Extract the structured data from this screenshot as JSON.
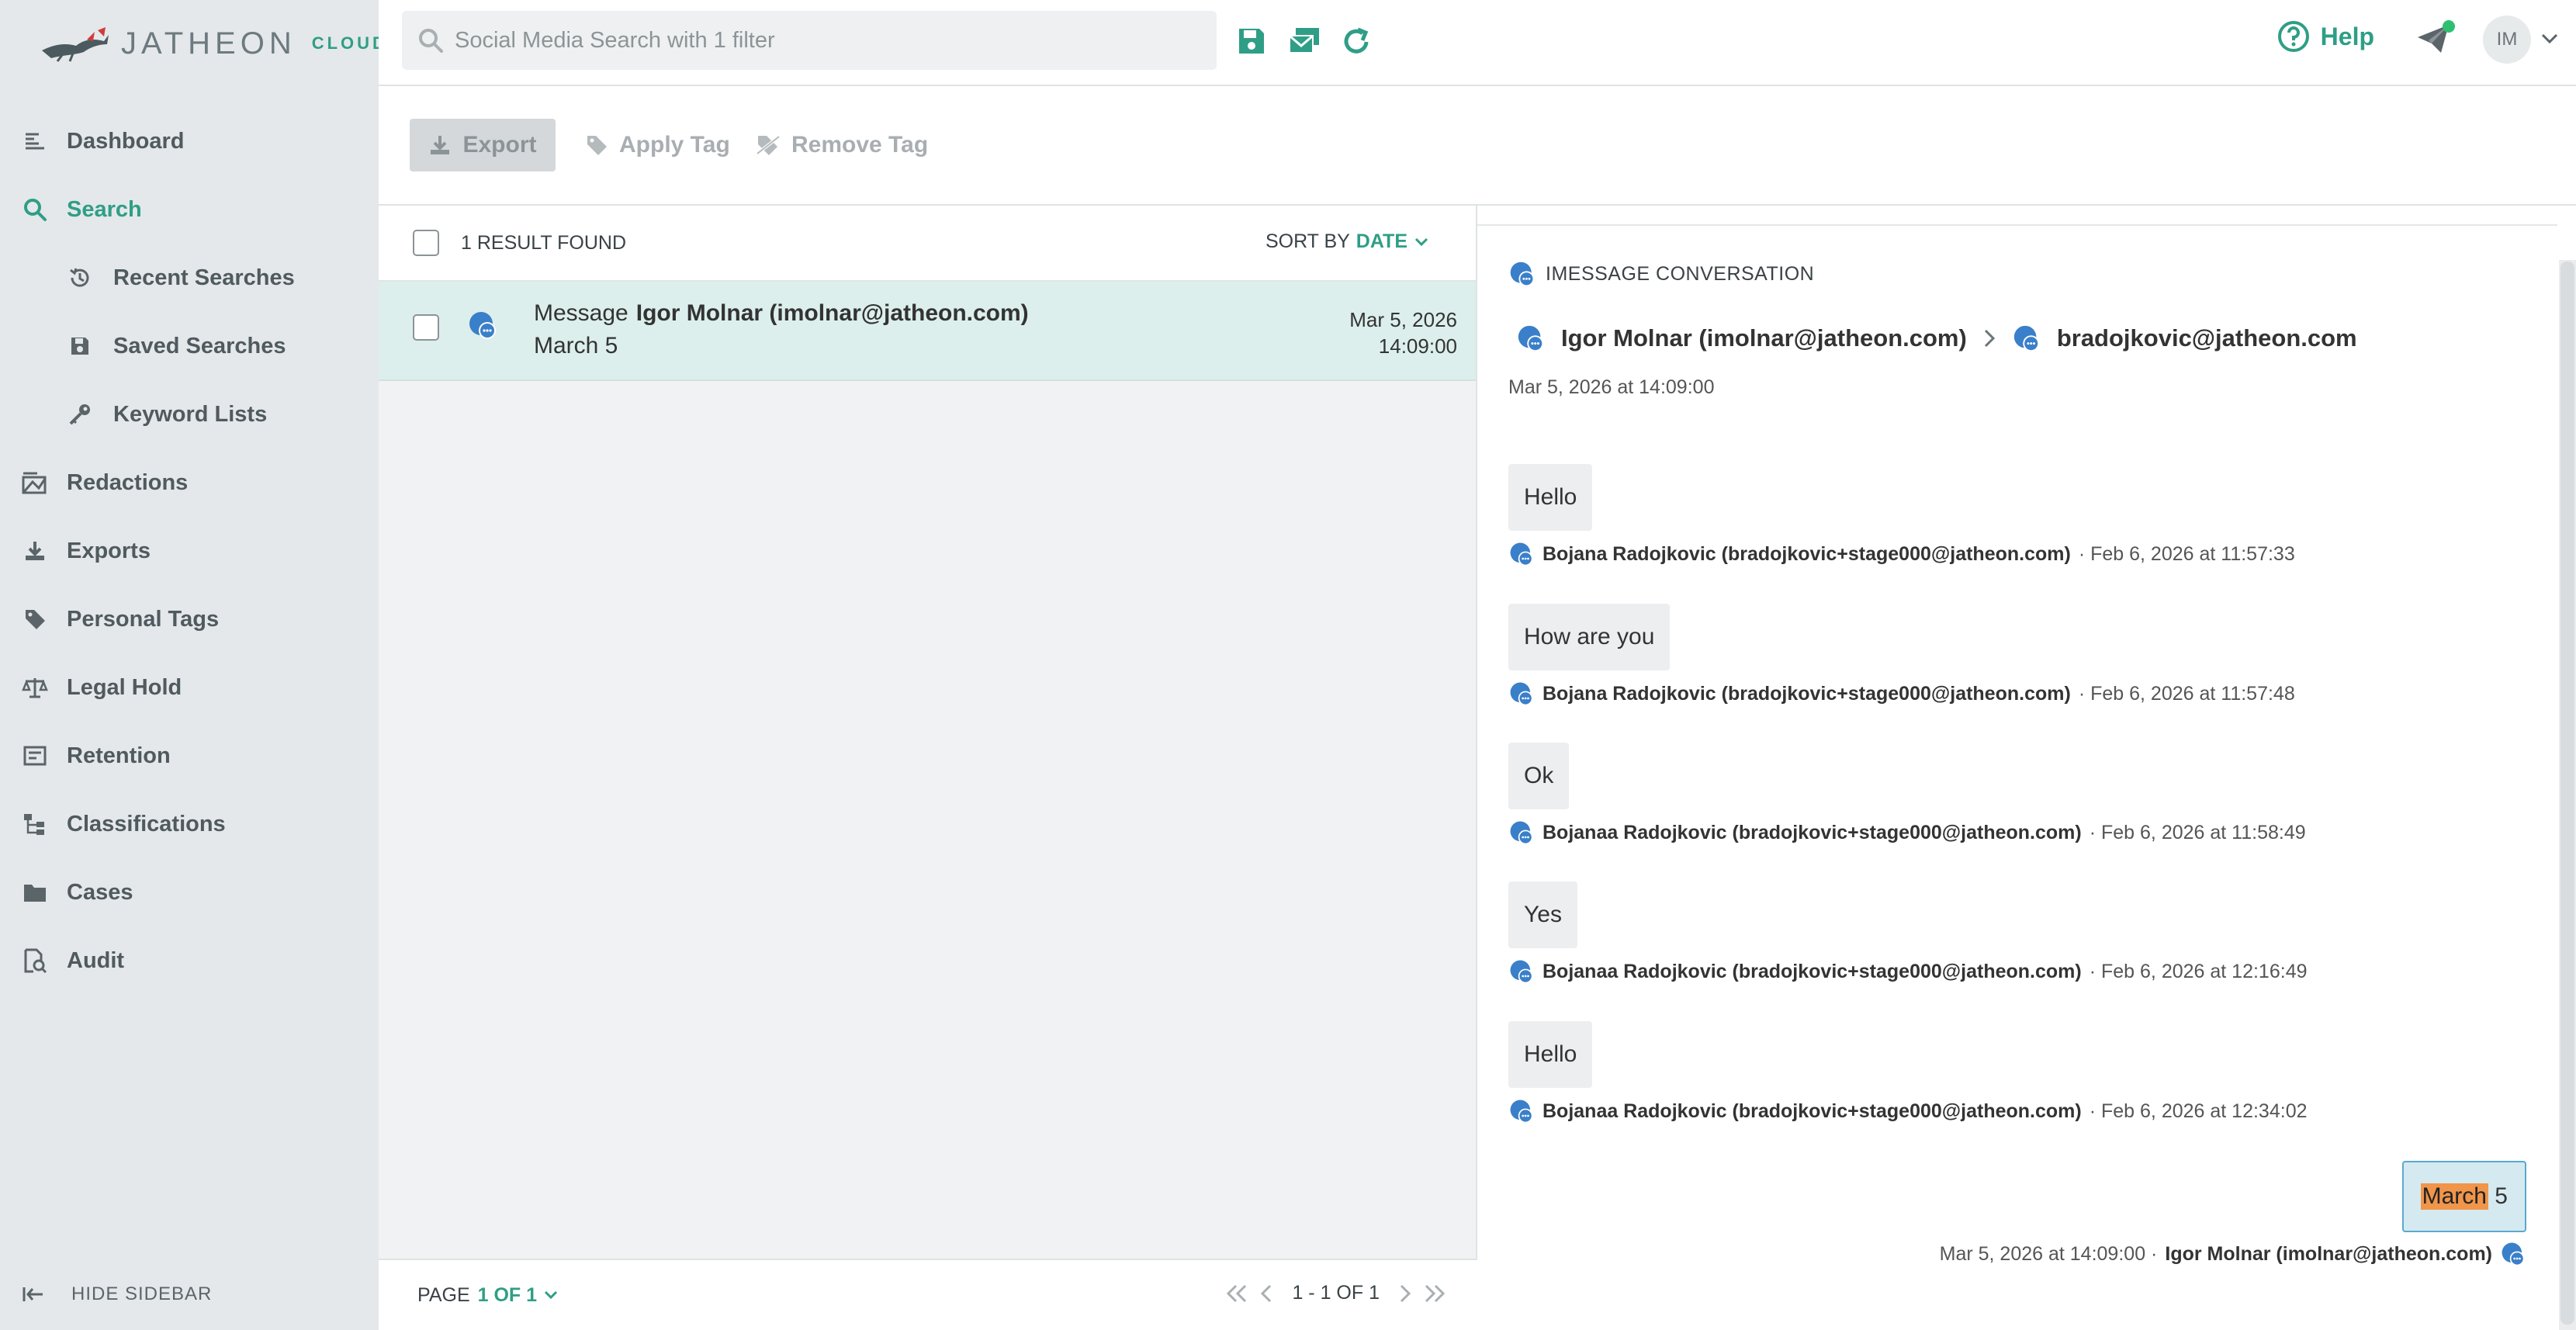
{
  "brand": {
    "logo_word": "JATHEON",
    "logo_suffix": "CLOUD",
    "accent": "#2f9e86"
  },
  "sidebar": {
    "items": [
      {
        "label": "Dashboard",
        "icon": "dashboard-icon"
      },
      {
        "label": "Search",
        "icon": "search-icon",
        "active": true
      },
      {
        "label": "Recent Searches",
        "icon": "history-icon",
        "sub": true
      },
      {
        "label": "Saved Searches",
        "icon": "save-icon",
        "sub": true
      },
      {
        "label": "Keyword Lists",
        "icon": "key-icon",
        "sub": true
      },
      {
        "label": "Redactions",
        "icon": "redaction-icon"
      },
      {
        "label": "Exports",
        "icon": "download-icon"
      },
      {
        "label": "Personal Tags",
        "icon": "tag-icon"
      },
      {
        "label": "Legal Hold",
        "icon": "scale-icon"
      },
      {
        "label": "Retention",
        "icon": "retention-icon"
      },
      {
        "label": "Classifications",
        "icon": "hierarchy-icon"
      },
      {
        "label": "Cases",
        "icon": "folder-icon"
      },
      {
        "label": "Audit",
        "icon": "audit-icon"
      }
    ],
    "hide_label": "HIDE SIDEBAR"
  },
  "topbar": {
    "search_placeholder": "Social Media Search with 1 filter",
    "help_label": "Help",
    "avatar_initials": "IM"
  },
  "actions": {
    "export": "Export",
    "apply_tag": "Apply Tag",
    "remove_tag": "Remove Tag"
  },
  "results": {
    "count_label": "1 RESULT FOUND",
    "sort_label": "SORT BY",
    "sort_value": "DATE",
    "rows": [
      {
        "type": "Message",
        "from": "Igor Molnar (imolnar@jatheon.com)",
        "subject": "March 5",
        "date": "Mar 5, 2026",
        "time": "14:09:00"
      }
    ],
    "pager": {
      "label": "PAGE",
      "value": "1 OF 1",
      "range": "1 - 1 OF 1"
    }
  },
  "detail": {
    "conversation_type": "IMESSAGE CONVERSATION",
    "from": "Igor Molnar (imolnar@jatheon.com)",
    "to": "bradojkovic@jatheon.com",
    "date": "Mar 5, 2026 at 14:09:00",
    "messages": [
      {
        "text": "Hello",
        "sender": "Bojana Radojkovic (bradojkovic+stage000@jatheon.com)",
        "timestamp": "· Feb 6, 2026 at 11:57:33"
      },
      {
        "text": "How are you",
        "sender": "Bojana Radojkovic (bradojkovic+stage000@jatheon.com)",
        "timestamp": "· Feb 6, 2026 at 11:57:48"
      },
      {
        "text": "Ok",
        "sender": "Bojanaa Radojkovic (bradojkovic+stage000@jatheon.com)",
        "timestamp": "· Feb 6, 2026 at 11:58:49"
      },
      {
        "text": "Yes",
        "sender": "Bojanaa Radojkovic (bradojkovic+stage000@jatheon.com)",
        "timestamp": "· Feb 6, 2026 at 12:16:49"
      },
      {
        "text": "Hello",
        "sender": "Bojanaa Radojkovic (bradojkovic+stage000@jatheon.com)",
        "timestamp": "· Feb 6, 2026 at 12:34:02"
      }
    ],
    "outgoing": {
      "highlight": "March",
      "rest": " 5",
      "timestamp": "Mar 5, 2026 at 14:09:00 ·",
      "sender": "Igor Molnar (imolnar@jatheon.com)"
    }
  }
}
